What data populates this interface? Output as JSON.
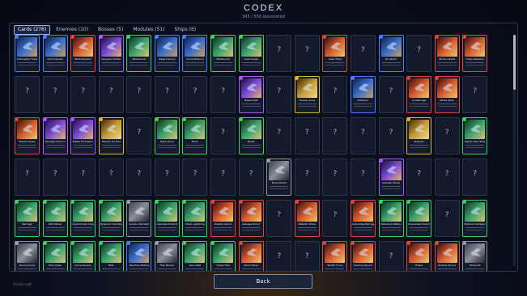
{
  "header": {
    "title": "CODEX",
    "subtitle": "345 / 550 discovered"
  },
  "tabs": [
    {
      "label": "Cards (276)",
      "active": true
    },
    {
      "label": "Enemies (10)",
      "active": false
    },
    {
      "label": "Bosses (5)",
      "active": false
    },
    {
      "label": "Modules (51)",
      "active": false
    },
    {
      "label": "Ships (6)",
      "active": false
    }
  ],
  "unknown_glyph": "?",
  "back_label": "Back",
  "logo_text": "Voidcraft",
  "rarity_colors": {
    "gray": "#8e97a8",
    "blue": "#4f7dff",
    "green": "#3cd45a",
    "purple": "#b257ff",
    "gold": "#e0b53a",
    "red": "#e0453a"
  },
  "cards": [
    {
      "name": "Interceptor Fleet",
      "rarity": "blue"
    },
    {
      "name": "Acid Torpedo",
      "rarity": "blue"
    },
    {
      "name": "Multi-Torpedo",
      "rarity": "red"
    },
    {
      "name": "Vanguard Strike",
      "rarity": "purple"
    },
    {
      "name": "Afterburner",
      "rarity": "green"
    },
    {
      "name": "Siege Cannon",
      "rarity": "blue"
    },
    {
      "name": "Scout Protocol",
      "rarity": "blue"
    },
    {
      "name": "Afterburner",
      "rarity": "green"
    },
    {
      "name": "Overcharge",
      "rarity": "green"
    },
    null,
    null,
    {
      "name": "Solar Flare",
      "rarity": "red"
    },
    null,
    {
      "name": "Ion Storm",
      "rarity": "blue"
    },
    null,
    {
      "name": "Photon Burst",
      "rarity": "red"
    },
    {
      "name": "Chain Reaction",
      "rarity": "red"
    },
    null,
    null,
    null,
    null,
    null,
    null,
    null,
    null,
    {
      "name": "Phase Shift",
      "rarity": "purple"
    },
    null,
    {
      "name": "Tracker Array",
      "rarity": "gold"
    },
    null,
    {
      "name": "Deflector",
      "rarity": "blue"
    },
    null,
    {
      "name": "Ion Barrage",
      "rarity": "red"
    },
    {
      "name": "Strike Team",
      "rarity": "red"
    },
    null,
    {
      "name": "Missile Volley",
      "rarity": "red"
    },
    {
      "name": "Salvage Protocol",
      "rarity": "purple"
    },
    {
      "name": "Battle Formation",
      "rarity": "purple"
    },
    {
      "name": "Reinforced Hull",
      "rarity": "gold"
    },
    null,
    {
      "name": "Warp Drive",
      "rarity": "green"
    },
    {
      "name": "Blink",
      "rarity": "green"
    },
    null,
    {
      "name": "Boost",
      "rarity": "green"
    },
    null,
    null,
    null,
    null,
    null,
    {
      "name": "Bulwark",
      "rarity": "gold"
    },
    null,
    {
      "name": "Repair Nanobots",
      "rarity": "green"
    },
    null,
    null,
    null,
    null,
    null,
    null,
    null,
    null,
    null,
    {
      "name": "Nova Shield",
      "rarity": "gray"
    },
    null,
    null,
    null,
    {
      "name": "Ambush Strike",
      "rarity": "purple"
    },
    null,
    null,
    null,
    {
      "name": "Barrage",
      "rarity": "green"
    },
    {
      "name": "Bolt Strike",
      "rarity": "green"
    },
    {
      "name": "Overclocked Core",
      "rarity": "green"
    },
    {
      "name": "Hyperion Discharge",
      "rarity": "green"
    },
    {
      "name": "Cluster Warhead",
      "rarity": "gray"
    },
    {
      "name": "Cascade Protocol",
      "rarity": "green"
    },
    {
      "name": "Chain Lightning",
      "rarity": "green"
    },
    {
      "name": "Plasma Lance",
      "rarity": "red"
    },
    {
      "name": "Salvage Drone",
      "rarity": "red"
    },
    null,
    {
      "name": "Ballistic Strike",
      "rarity": "red"
    },
    null,
    {
      "name": "Cascading Barrage",
      "rarity": "red"
    },
    {
      "name": "Defensive Battery",
      "rarity": "green"
    },
    {
      "name": "Overwhelm Salvos",
      "rarity": "green"
    },
    null,
    {
      "name": "Tactical Intelligence",
      "rarity": "green"
    },
    {
      "name": "Decoy Drone",
      "rarity": "gray"
    },
    {
      "name": "Emp Pulse",
      "rarity": "green"
    },
    {
      "name": "Drone Swarm",
      "rarity": "green"
    },
    {
      "name": "Blitz",
      "rarity": "green"
    },
    {
      "name": "Reactive Plating",
      "rarity": "blue"
    },
    {
      "name": "Flak Barrier",
      "rarity": "gray"
    },
    {
      "name": "Grav Well",
      "rarity": "green"
    },
    {
      "name": "Dread Tide",
      "rarity": "green"
    },
    {
      "name": "Shock Wave",
      "rarity": "red"
    },
    null,
    null,
    {
      "name": "Wraith Force",
      "rarity": "red"
    },
    {
      "name": "Piercing Round",
      "rarity": "red"
    },
    null,
    {
      "name": "Ember",
      "rarity": "red"
    },
    {
      "name": "Tactical Choice",
      "rarity": "red"
    },
    {
      "name": "Strike Kit",
      "rarity": "gray"
    }
  ]
}
